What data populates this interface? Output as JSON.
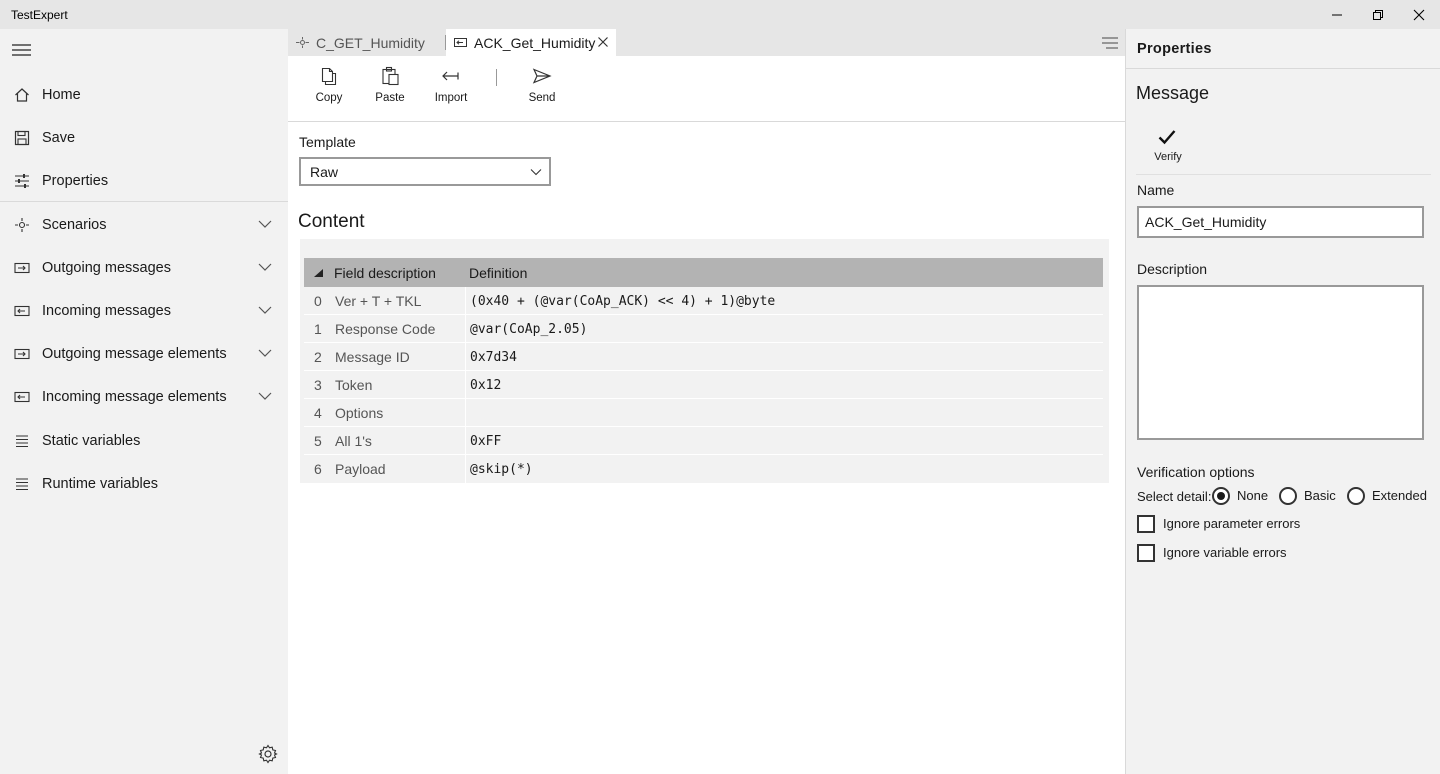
{
  "app": {
    "title": "TestExpert"
  },
  "window_controls": {
    "minimize": "minimize-icon",
    "restore": "restore-icon",
    "close": "close-icon"
  },
  "nav": {
    "items": [
      {
        "label": "Home",
        "icon": "home-icon"
      },
      {
        "label": "Save",
        "icon": "save-icon"
      },
      {
        "label": "Properties",
        "icon": "properties-icon"
      },
      {
        "label": "Scenarios",
        "icon": "scenarios-icon",
        "expandable": true
      },
      {
        "label": "Outgoing messages",
        "icon": "outgoing-messages-icon",
        "expandable": true
      },
      {
        "label": "Incoming messages",
        "icon": "incoming-messages-icon",
        "expandable": true
      },
      {
        "label": "Outgoing message elements",
        "icon": "outgoing-elements-icon",
        "expandable": true
      },
      {
        "label": "Incoming message elements",
        "icon": "incoming-elements-icon",
        "expandable": true
      },
      {
        "label": "Static variables",
        "icon": "list-icon"
      },
      {
        "label": "Runtime variables",
        "icon": "list-icon"
      }
    ]
  },
  "tabs": [
    {
      "label": "C_GET_Humidity",
      "active": false
    },
    {
      "label": "ACK_Get_Humidity",
      "active": true
    }
  ],
  "toolbar": {
    "copy": "Copy",
    "paste": "Paste",
    "import": "Import",
    "send": "Send"
  },
  "template": {
    "label": "Template",
    "value": "Raw"
  },
  "content": {
    "title": "Content",
    "header": {
      "field": "Field description",
      "definition": "Definition"
    },
    "rows": [
      {
        "index": "0",
        "field": "Ver + T + TKL",
        "definition": "(0x40 + (@var(CoAp_ACK) << 4) + 1)@byte"
      },
      {
        "index": "1",
        "field": "Response Code",
        "definition": "@var(CoAp_2.05)"
      },
      {
        "index": "2",
        "field": "Message ID",
        "definition": "0x7d34"
      },
      {
        "index": "3",
        "field": "Token",
        "definition": "0x12"
      },
      {
        "index": "4",
        "field": "Options",
        "definition": ""
      },
      {
        "index": "5",
        "field": "All 1's",
        "definition": "0xFF"
      },
      {
        "index": "6",
        "field": "Payload",
        "definition": "@skip(*)"
      }
    ]
  },
  "properties": {
    "title": "Properties",
    "section": "Message",
    "verify": "Verify",
    "name_label": "Name",
    "name_value": "ACK_Get_Humidity",
    "description_label": "Description",
    "description_value": "",
    "verification_label": "Verification options",
    "select_detail": "Select detail:",
    "radios": [
      {
        "label": "None",
        "checked": true
      },
      {
        "label": "Basic",
        "checked": false
      },
      {
        "label": "Extended",
        "checked": false
      }
    ],
    "checks": [
      {
        "label": "Ignore parameter errors",
        "checked": false
      },
      {
        "label": "Ignore variable errors",
        "checked": false
      }
    ]
  }
}
